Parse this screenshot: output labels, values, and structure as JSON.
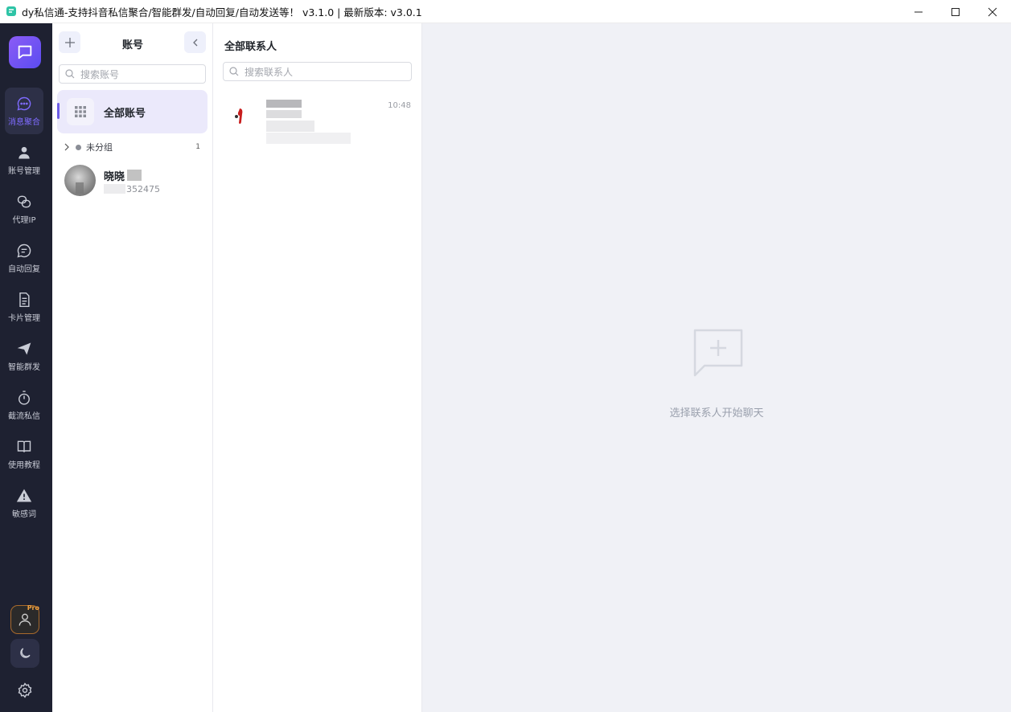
{
  "window": {
    "title": "dy私信通-支持抖音私信聚合/智能群发/自动回复/自动发送等！  v3.1.0 | 最新版本: v3.0.1"
  },
  "rail": {
    "items": [
      {
        "label": "消息聚合",
        "icon": "chat-bubble-icon",
        "active": true
      },
      {
        "label": "账号管理",
        "icon": "user-icon"
      },
      {
        "label": "代理IP",
        "icon": "proxy-icon"
      },
      {
        "label": "自动回复",
        "icon": "reply-bubble-icon"
      },
      {
        "label": "卡片管理",
        "icon": "document-icon"
      },
      {
        "label": "智能群发",
        "icon": "send-icon"
      },
      {
        "label": "截流私信",
        "icon": "stopwatch-icon"
      },
      {
        "label": "使用教程",
        "icon": "book-icon"
      },
      {
        "label": "敏感词",
        "icon": "warning-icon"
      }
    ],
    "pro_badge": "Pro"
  },
  "accounts": {
    "title": "账号",
    "search_placeholder": "搜索账号",
    "all_label": "全部账号",
    "group": {
      "name": "未分组",
      "count": "1"
    },
    "items": [
      {
        "name": "晓晓",
        "sub": "352475"
      }
    ]
  },
  "contacts": {
    "title": "全部联系人",
    "search_placeholder": "搜索联系人",
    "items": [
      {
        "time": "10:48"
      }
    ]
  },
  "chat": {
    "empty_text": "选择联系人开始聊天"
  },
  "colors": {
    "rail_bg": "#1e2131",
    "accent": "#6c5ce7",
    "chat_bg": "#f0f1f6"
  }
}
